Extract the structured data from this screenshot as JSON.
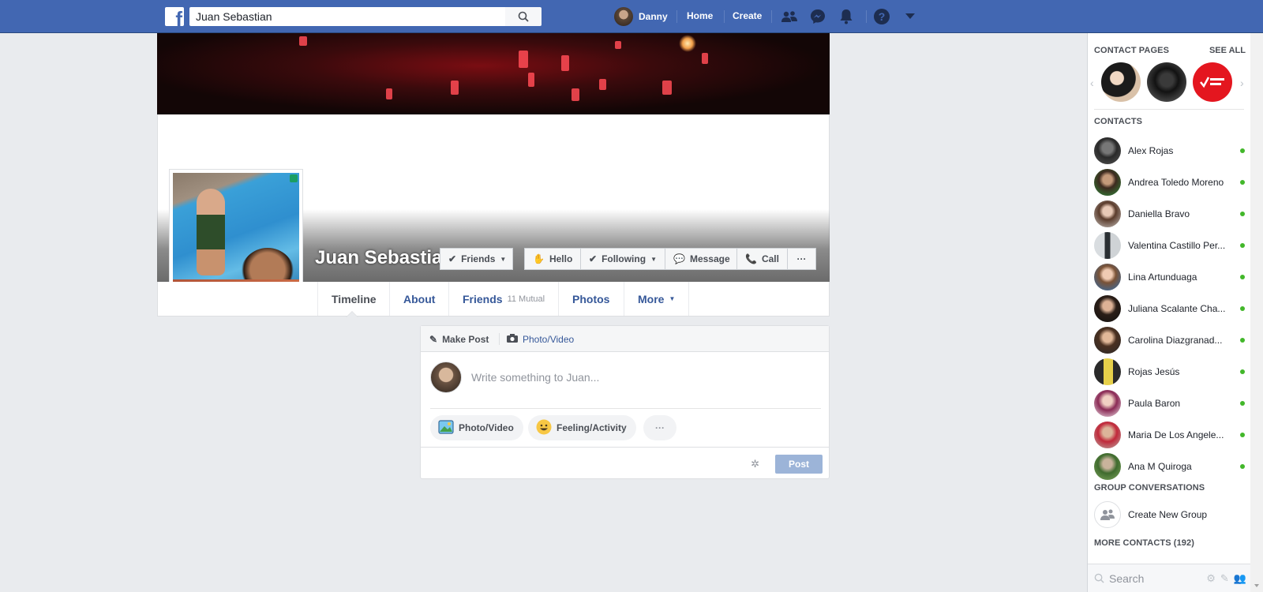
{
  "topbar": {
    "search_value": "Juan Sebastian",
    "user_name": "Danny",
    "home_label": "Home",
    "create_label": "Create"
  },
  "profile": {
    "name": "Juan Sebastian",
    "actions": {
      "friends_label": "Friends",
      "hello_label": "Hello",
      "following_label": "Following",
      "message_label": "Message",
      "call_label": "Call",
      "more_label": "···"
    },
    "tabs": [
      {
        "label": "Timeline",
        "active": true
      },
      {
        "label": "About"
      },
      {
        "label": "Friends",
        "sub": "11 Mutual"
      },
      {
        "label": "Photos"
      },
      {
        "label": "More"
      }
    ]
  },
  "composer": {
    "make_post_label": "Make Post",
    "photo_video_label": "Photo/Video",
    "placeholder": "Write something to Juan...",
    "pill_photo_label": "Photo/Video",
    "pill_feeling_label": "Feeling/Activity",
    "pill_more_label": "···",
    "post_label": "Post"
  },
  "sidebar": {
    "contact_pages_title": "CONTACT PAGES",
    "see_all_label": "SEE ALL",
    "contacts_title": "CONTACTS",
    "contacts": [
      {
        "name": "Alex Rojas",
        "online": true
      },
      {
        "name": "Andrea Toledo Moreno",
        "online": true
      },
      {
        "name": "Daniella Bravo",
        "online": true
      },
      {
        "name": "Valentina Castillo Per...",
        "online": true
      },
      {
        "name": "Lina Artunduaga",
        "online": true
      },
      {
        "name": "Juliana Scalante Cha...",
        "online": true
      },
      {
        "name": "Carolina Diazgranad...",
        "online": true
      },
      {
        "name": "Rojas Jesús",
        "online": true
      },
      {
        "name": "Paula Baron",
        "online": true
      },
      {
        "name": "Maria De Los Angele...",
        "online": true
      },
      {
        "name": "Ana M Quiroga",
        "online": true
      }
    ],
    "group_conversations_title": "GROUP CONVERSATIONS",
    "create_group_label": "Create New Group",
    "more_contacts_title": "MORE CONTACTS (192)",
    "search_placeholder": "Search"
  },
  "colors": {
    "brand_blue": "#4267b2",
    "link_blue": "#365899",
    "online_green": "#42b72a",
    "post_button_disabled": "#9cb4d8"
  }
}
